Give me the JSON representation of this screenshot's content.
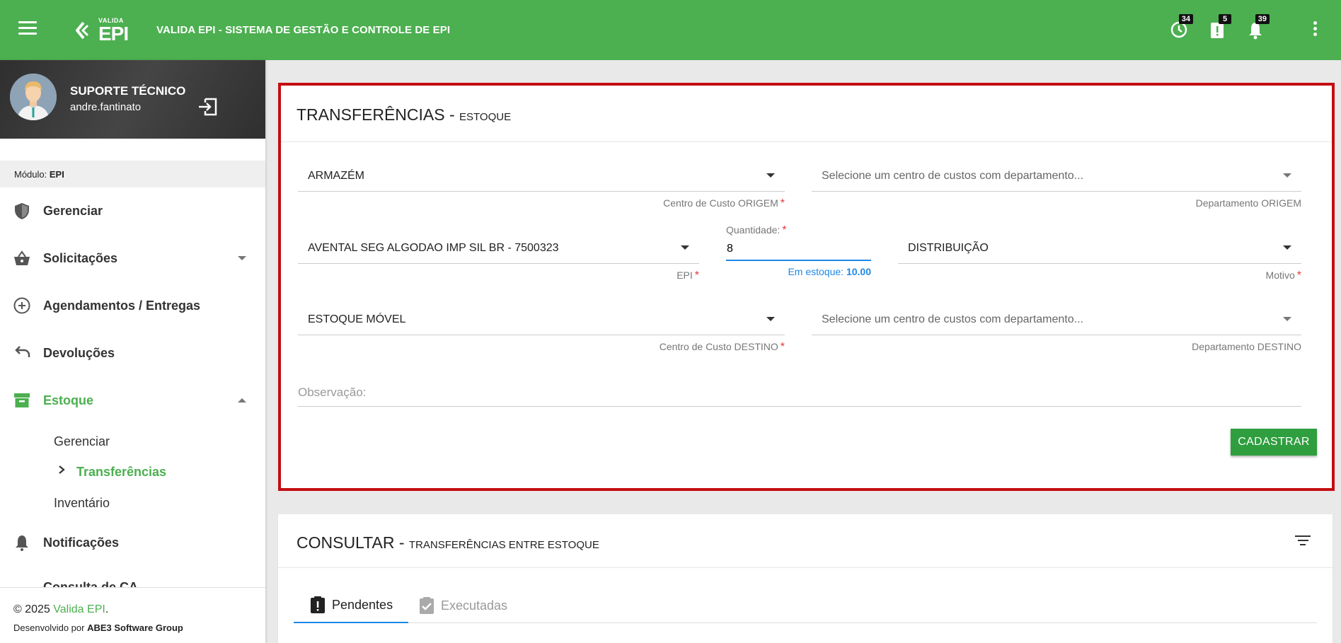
{
  "header": {
    "logo_small": "VALIDA",
    "logo_big": "EPI",
    "app_title": "VALIDA EPI - SISTEMA DE GESTÃO E CONTROLE DE EPI",
    "badges": {
      "history": "34",
      "alerts": "5",
      "notifications": "39"
    },
    "colors": {
      "primary": "#4caf50"
    }
  },
  "user": {
    "role": "SUPORTE TÉCNICO",
    "login": "andre.fantinato"
  },
  "sidebar": {
    "module_label": "Módulo:",
    "module_value": "EPI",
    "items": {
      "gerenciar": "Gerenciar",
      "solicitacoes": "Solicitações",
      "agendamentos": "Agendamentos / Entregas",
      "devolucoes": "Devoluções",
      "estoque": "Estoque",
      "notificacoes": "Notificações",
      "consulta": "Consulta de CA"
    },
    "estoque_sub": {
      "gerenciar": "Gerenciar",
      "transferencias": "Transferências",
      "inventario": "Inventário"
    },
    "footer": {
      "copyright": "© 2025",
      "brand": "Valida EPI",
      "dev_prefix": "Desenvolvido por",
      "dev_company": "ABE3 Software Group"
    }
  },
  "form": {
    "title": "TRANSFERÊNCIAS -",
    "subtitle": "ESTOQUE",
    "origin_cc": {
      "value": "ARMAZÉM",
      "hint": "Centro de Custo ORIGEM"
    },
    "origin_dept": {
      "placeholder": "Selecione um centro de custos com departamento...",
      "hint": "Departamento ORIGEM"
    },
    "epi": {
      "value": "AVENTAL SEG ALGODAO IMP SIL BR - 7500323",
      "hint": "EPI"
    },
    "quantity": {
      "label": "Quantidade:",
      "value": "8",
      "stock_label": "Em estoque:",
      "stock_value": "10.00"
    },
    "reason": {
      "value": "DISTRIBUIÇÃO",
      "hint": "Motivo"
    },
    "dest_cc": {
      "value": "ESTOQUE MÓVEL",
      "hint": "Centro de Custo DESTINO"
    },
    "dest_dept": {
      "placeholder": "Selecione um centro de custos com departamento...",
      "hint": "Departamento DESTINO"
    },
    "observation": {
      "placeholder": "Observação:"
    },
    "submit_label": "CADASTRAR",
    "required_mark": "*"
  },
  "consult": {
    "title": "CONSULTAR -",
    "subtitle": "TRANSFERÊNCIAS ENTRE ESTOQUE",
    "tabs": {
      "pending": "Pendentes",
      "executed": "Executadas"
    }
  }
}
